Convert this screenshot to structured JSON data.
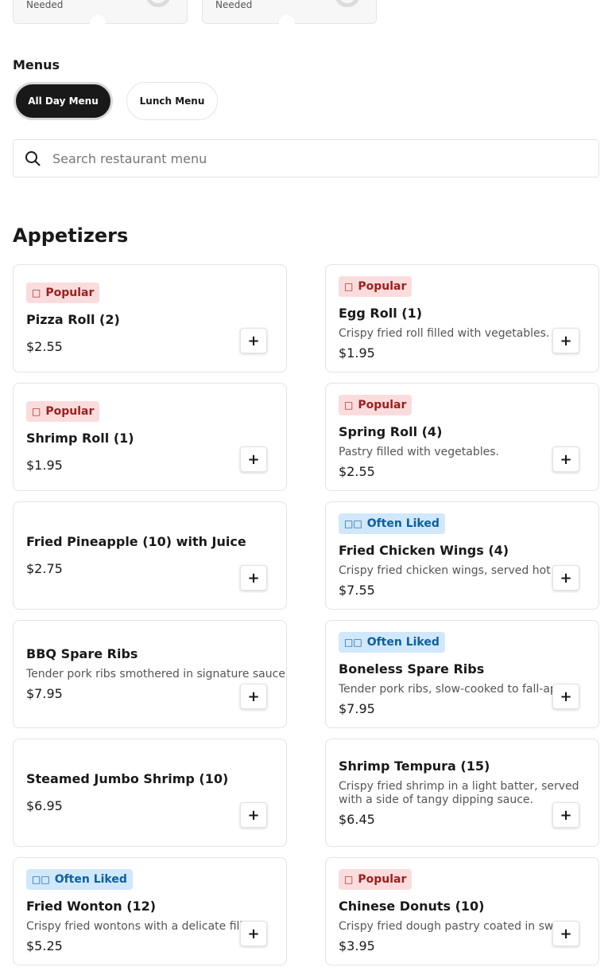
{
  "top_cards": [
    {
      "label": "Needed"
    },
    {
      "label": "Needed"
    }
  ],
  "menus": {
    "heading": "Menus",
    "tabs": [
      {
        "label": "All Day Menu",
        "active": true
      },
      {
        "label": "Lunch Menu",
        "active": false
      }
    ]
  },
  "search": {
    "placeholder": "Search restaurant menu",
    "icon": "search-icon"
  },
  "section": {
    "title": "Appetizers"
  },
  "badge_icons": {
    "Popular": "fire-icon",
    "Often Liked": "thumbs-up-icon"
  },
  "items": [
    {
      "badge": "Popular",
      "name": "Pizza Roll (2)",
      "description": "",
      "price": "$2.55"
    },
    {
      "badge": "Popular",
      "name": "Egg Roll (1)",
      "description": "Crispy fried roll filled with vegetables.",
      "price": "$1.95"
    },
    {
      "badge": "Popular",
      "name": "Shrimp Roll (1)",
      "description": "",
      "price": "$1.95"
    },
    {
      "badge": "Popular",
      "name": "Spring Roll (4)",
      "description": "Pastry filled with vegetables.",
      "price": "$2.55"
    },
    {
      "badge": "",
      "name": "Fried Pineapple (10) with Juice",
      "description": "",
      "price": "$2.75"
    },
    {
      "badge": "Often Liked",
      "name": "Fried Chicken Wings (4)",
      "description": "Crispy fried chicken wings, served hot",
      "price": "$7.55"
    },
    {
      "badge": "",
      "name": "BBQ Spare Ribs",
      "description": "Tender pork ribs smothered in signature sauce.",
      "price": "$7.95"
    },
    {
      "badge": "Often Liked",
      "name": "Boneless Spare Ribs",
      "description": "Tender pork ribs, slow-cooked to fall-apart.",
      "price": "$7.95"
    },
    {
      "badge": "",
      "name": "Steamed Jumbo Shrimp (10)",
      "description": "",
      "price": "$6.95"
    },
    {
      "badge": "",
      "name": "Shrimp Tempura (15)",
      "description": "Crispy fried shrimp in a light batter, served with a side of tangy dipping sauce.",
      "price": "$6.45"
    },
    {
      "badge": "Often Liked",
      "name": "Fried Wonton (12)",
      "description": "Crispy fried wontons with a delicate filling.",
      "price": "$5.25"
    },
    {
      "badge": "Popular",
      "name": "Chinese Donuts (10)",
      "description": "Crispy fried dough pastry coated in sweet.",
      "price": "$3.95"
    }
  ],
  "add_button_label": "+",
  "colors": {
    "active_tab_bg": "#191919",
    "popular_badge_bg": "#fbdcdc",
    "popular_badge_text": "#9a1f1f",
    "liked_badge_bg": "#d1e8fb",
    "liked_badge_text": "#0d5fa0"
  }
}
